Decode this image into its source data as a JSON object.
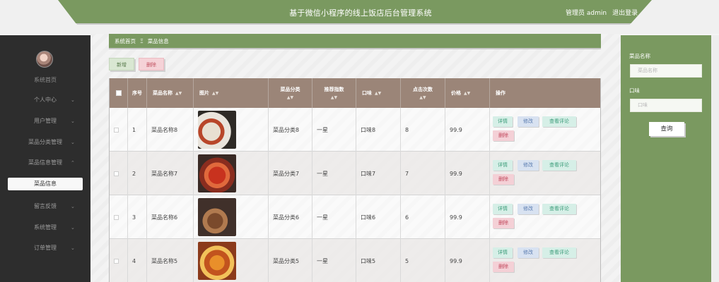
{
  "header": {
    "title": "基于微信小程序的线上饭店后台管理系统",
    "user_label": "管理员 admin",
    "logout": "退出登录"
  },
  "sidebar": {
    "home": "系统首页",
    "items": [
      {
        "label": "个人中心"
      },
      {
        "label": "用户管理"
      },
      {
        "label": "菜品分类管理"
      },
      {
        "label": "菜品信息管理"
      },
      {
        "label": "留言反馈"
      },
      {
        "label": "系统管理"
      },
      {
        "label": "订单管理"
      }
    ],
    "active_sub": "菜品信息"
  },
  "breadcrumb": {
    "home": "系统首页",
    "sep": "Ξ",
    "current": "菜品信息"
  },
  "toolbar": {
    "add": "新增",
    "delete": "删除"
  },
  "table": {
    "columns": {
      "index": "序号",
      "name": "菜品名称",
      "image": "图片",
      "category": "菜品分类",
      "recommend": "推荐指数",
      "taste": "口味",
      "clicks": "点击次数",
      "price": "价格",
      "actions": "操作"
    },
    "rows": [
      {
        "index": "1",
        "name": "菜品名称8",
        "category": "菜品分类8",
        "recommend": "一星",
        "taste": "口味8",
        "clicks": "8",
        "price": "99.9"
      },
      {
        "index": "2",
        "name": "菜品名称7",
        "category": "菜品分类7",
        "recommend": "一星",
        "taste": "口味7",
        "clicks": "7",
        "price": "99.9"
      },
      {
        "index": "3",
        "name": "菜品名称6",
        "category": "菜品分类6",
        "recommend": "一星",
        "taste": "口味6",
        "clicks": "6",
        "price": "99.9"
      },
      {
        "index": "4",
        "name": "菜品名称5",
        "category": "菜品分类5",
        "recommend": "一星",
        "taste": "口味5",
        "clicks": "5",
        "price": "99.9"
      }
    ],
    "row_actions": {
      "detail": "详情",
      "edit": "修改",
      "review": "查看评论",
      "delete": "删除"
    }
  },
  "search_panel": {
    "name_label": "菜品名称",
    "name_placeholder": "菜品名称",
    "taste_label": "口味",
    "taste_placeholder": "口味",
    "search_button": "查询"
  },
  "colors": {
    "accent": "#7a9960",
    "table_header": "#9b8578",
    "sidebar": "#2d2d2d"
  }
}
